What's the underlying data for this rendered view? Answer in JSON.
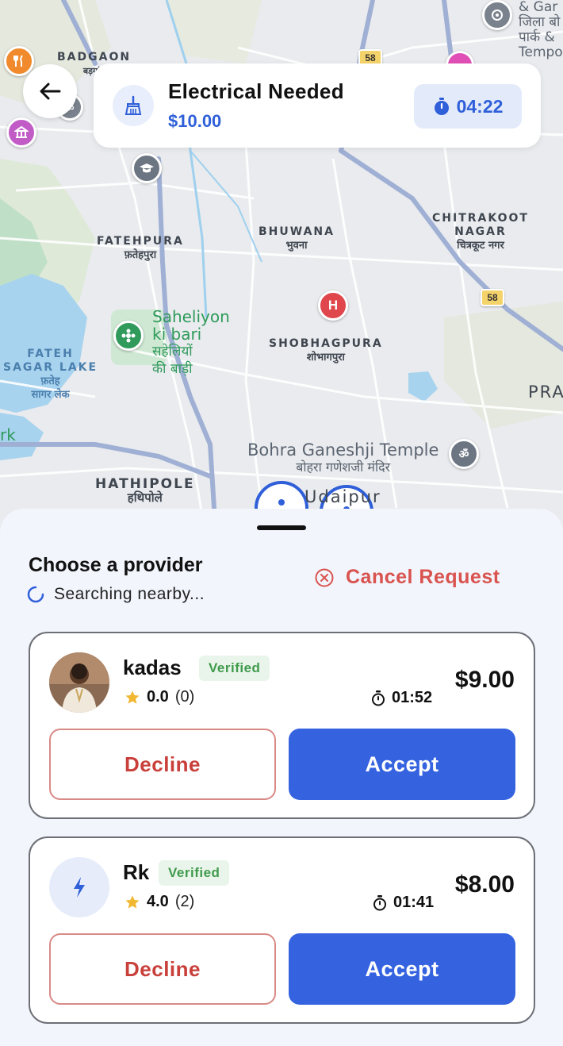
{
  "map": {
    "labels": {
      "badgaon": "BADGAON",
      "badgaon_hi": "बड़गांव",
      "fatehpura": "FATEHPURA",
      "fatehpura_hi": "फ़तेहपुरा",
      "bhuwana": "BHUWANA",
      "bhuwana_hi": "भुवना",
      "chitrakoot1": "CHITRAKOOT",
      "chitrakoot2": "NAGAR",
      "chitrakoot_hi": "चित्रकूट नगर",
      "saheliyon1": "Saheliyon",
      "saheliyon2": "ki bari",
      "saheliyon_hi1": "सहेलियों",
      "saheliyon_hi2": "की बाड़ी",
      "fateh_sagar1": "FATEH",
      "fateh_sagar2": "SAGAR LAKE",
      "fateh_sagar_hi1": "फ़तेह",
      "fateh_sagar_hi2": "सागर लेक",
      "shobhagpura": "SHOBHAGPURA",
      "shobhagpura_hi": "शोभागपुरा",
      "bohra_temple": "Bohra Ganeshji Temple",
      "bohra_temple_hi": "बोहरा गणेशजी मंदिर",
      "hathipole": "HATHIPOLE",
      "hathipole_hi": "हथिपोले",
      "udaipur": "Udaipur",
      "pra": "PRA",
      "rk": "rk",
      "garden_top1": "& Gar",
      "garden_top2": "जिला बो",
      "garden_top3": "पार्क &",
      "garden_top4": "Tempo",
      "highway1": "58",
      "highway2": "58",
      "hospital": "H"
    }
  },
  "header": {
    "back_icon": "arrow-left-icon",
    "job_icon": "broom-icon",
    "job_title": "Electrical Needed",
    "job_price": "$10.00",
    "timer_icon": "stopwatch-icon",
    "timer": "04:22"
  },
  "sheet": {
    "title": "Choose a provider",
    "searching": "Searching nearby...",
    "cancel_label": "Cancel Request",
    "colors": {
      "accent": "#3563e0",
      "danger": "#d9534f",
      "verified_bg": "#e9f5ea"
    }
  },
  "providers": [
    {
      "name": "kadas",
      "badge": "Verified",
      "score": "0.0",
      "count": "(0)",
      "eta": "01:52",
      "price": "$9.00",
      "decline": "Decline",
      "accept": "Accept",
      "avatar": "photo"
    },
    {
      "name": "Rk",
      "badge": "Verified",
      "score": "4.0",
      "count": "(2)",
      "eta": "01:41",
      "price": "$8.00",
      "decline": "Decline",
      "accept": "Accept",
      "avatar": "bolt-icon"
    }
  ]
}
